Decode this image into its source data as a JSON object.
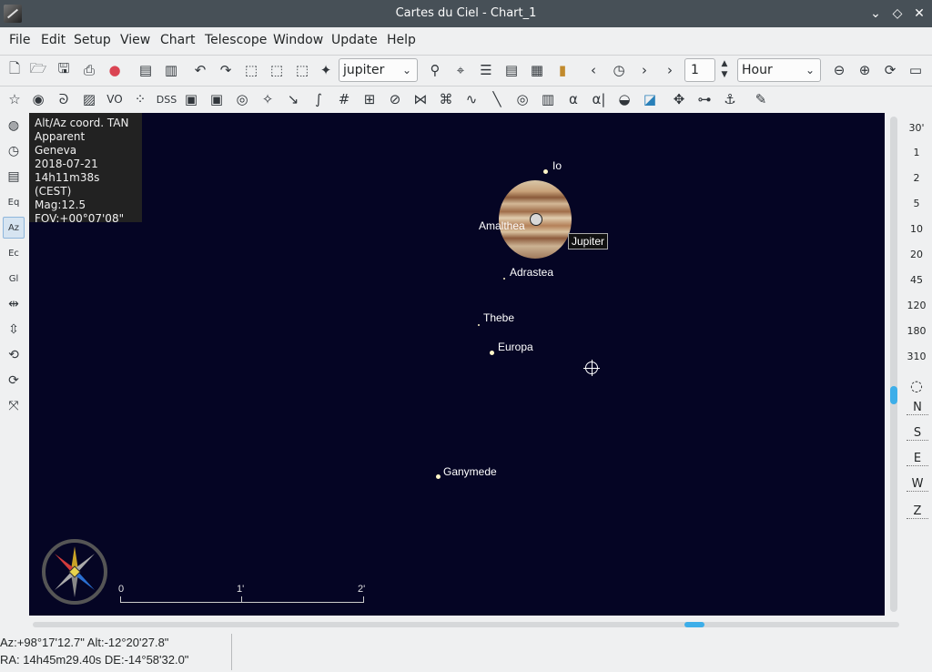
{
  "window": {
    "title": "Cartes du Ciel - Chart_1",
    "controls": [
      "⌄",
      "◇",
      "✕"
    ]
  },
  "menu": [
    "File",
    "Edit",
    "Setup",
    "View",
    "Chart",
    "Telescope",
    "Window",
    "Update",
    "Help"
  ],
  "toolbar1": {
    "search_value": "jupiter",
    "step_value": "1",
    "time_unit": "Hour"
  },
  "toolbar2": {
    "vo_label": "VO",
    "dss_label": "DSS",
    "alpha_label": "α",
    "alpha2_label": "α|"
  },
  "left_tools": [
    "Eq",
    "Az",
    "Ec",
    "Gl"
  ],
  "info_box": {
    "lines": [
      "Alt/Az coord. TAN",
      "Apparent",
      "Geneva",
      "2018-07-21",
      "14h11m38s (CEST)",
      "Mag:12.5",
      "FOV:+00°07'08\""
    ]
  },
  "chart": {
    "objects": {
      "io": "Io",
      "amalthea": "Amalthea",
      "jupiter": "Jupiter",
      "adrastea": "Adrastea",
      "thebe": "Thebe",
      "europa": "Europa",
      "ganymede": "Ganymede"
    },
    "scale_labels": [
      "0",
      "1'",
      "2'"
    ],
    "background_color": "#050524"
  },
  "fov_buttons": [
    "30'",
    "1",
    "2",
    "5",
    "10",
    "20",
    "45",
    "120",
    "180",
    "310"
  ],
  "direction_buttons": [
    "N",
    "S",
    "E",
    "W",
    "Z"
  ],
  "status": {
    "altaz": "Az:+98°17'12.7\" Alt:-12°20'27.8\"",
    "radec": "RA: 14h45m29.40s DE:-14°58'32.0\""
  }
}
